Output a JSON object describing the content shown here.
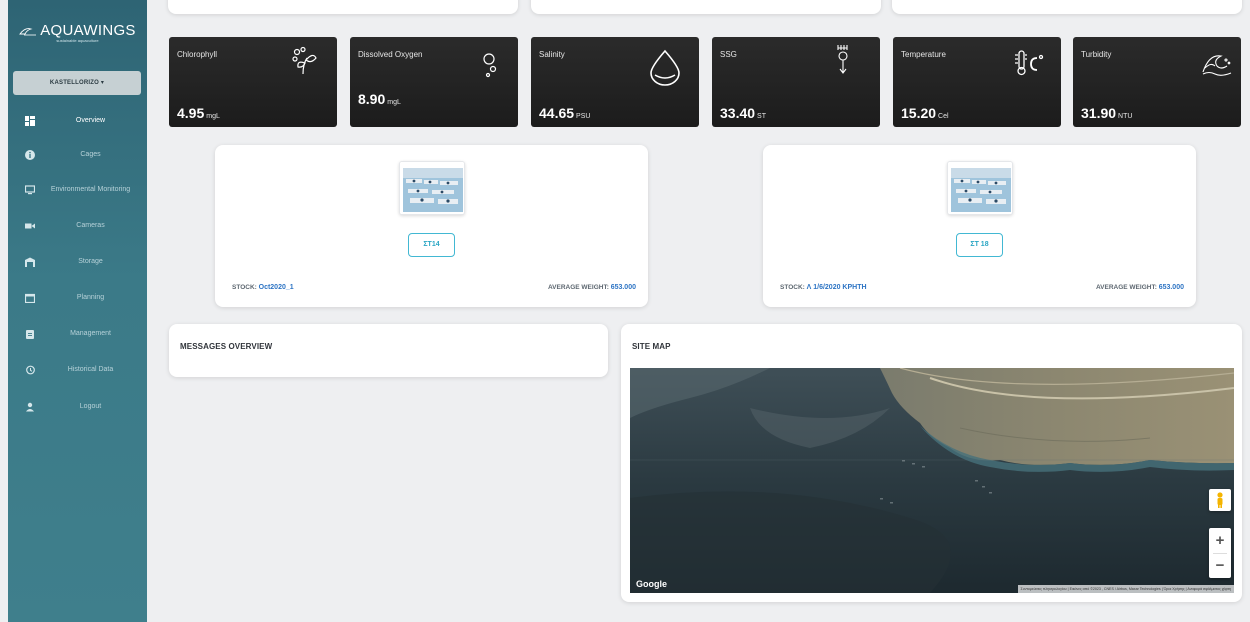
{
  "app": {
    "name": "AQUAWINGS",
    "tagline": "sustainable aquaculture"
  },
  "site_selector": {
    "value": "KASTELLORIZO ▾"
  },
  "nav": [
    {
      "label": "Overview",
      "icon": "dashboard-icon",
      "active": true
    },
    {
      "label": "Cages",
      "icon": "info-icon",
      "active": false
    },
    {
      "label": "Environmental Monitoring",
      "icon": "monitor-icon",
      "active": false
    },
    {
      "label": "Cameras",
      "icon": "videocam-icon",
      "active": false
    },
    {
      "label": "Storage",
      "icon": "warehouse-icon",
      "active": false
    },
    {
      "label": "Planning",
      "icon": "calendar-icon",
      "active": false
    },
    {
      "label": "Management",
      "icon": "clipboard-icon",
      "active": false
    },
    {
      "label": "Historical Data",
      "icon": "history-icon",
      "active": false
    },
    {
      "label": "Logout",
      "icon": "person-icon",
      "active": false
    }
  ],
  "metrics": [
    {
      "label": "Chlorophyll",
      "value": "4.95",
      "unit": "mgL",
      "icon": "plant-icon"
    },
    {
      "label": "Dissolved Oxygen",
      "value": "8.90",
      "unit": "mgL",
      "icon": "bubbles-icon"
    },
    {
      "label": "Salinity",
      "value": "44.65",
      "unit": "PSU",
      "icon": "water-drop-icon"
    },
    {
      "label": "SSG",
      "value": "33.40",
      "unit": "ST",
      "icon": "probe-icon"
    },
    {
      "label": "Temperature",
      "value": "15.20",
      "unit": "Cel",
      "icon": "thermometer-icon"
    },
    {
      "label": "Turbidity",
      "value": "31.90",
      "unit": "NTU",
      "icon": "waves-icon"
    }
  ],
  "cages": [
    {
      "button": "ΣΤ14",
      "stock_label": "STOCK:",
      "stock_value": "Oct2020_1",
      "weight_label": "AVERAGE WEIGHT:",
      "weight_value": "653.000"
    },
    {
      "button": "ΣΤ 18",
      "stock_label": "STOCK:",
      "stock_value": "Λ 1/6/2020 ΚΡΗΤΗ",
      "weight_label": "AVERAGE WEIGHT:",
      "weight_value": "653.000"
    }
  ],
  "messages": {
    "title": "MESSAGES OVERVIEW"
  },
  "site_map": {
    "title": "SITE MAP",
    "google": "Google",
    "attribution": "Συντομεύσεις πληκτρολογίου | Εικόνες από ©2023 , CNES / Airbus, Maxar Technologies | Όροι Χρήσης | Αναφορά σφάλματος χάρτη",
    "zoom_in": "+",
    "zoom_out": "−"
  },
  "colors": {
    "sidebar": "#3b7a88",
    "accent": "#2aa6c4",
    "link": "#2d74c4",
    "tile": "#1f1f1f"
  }
}
